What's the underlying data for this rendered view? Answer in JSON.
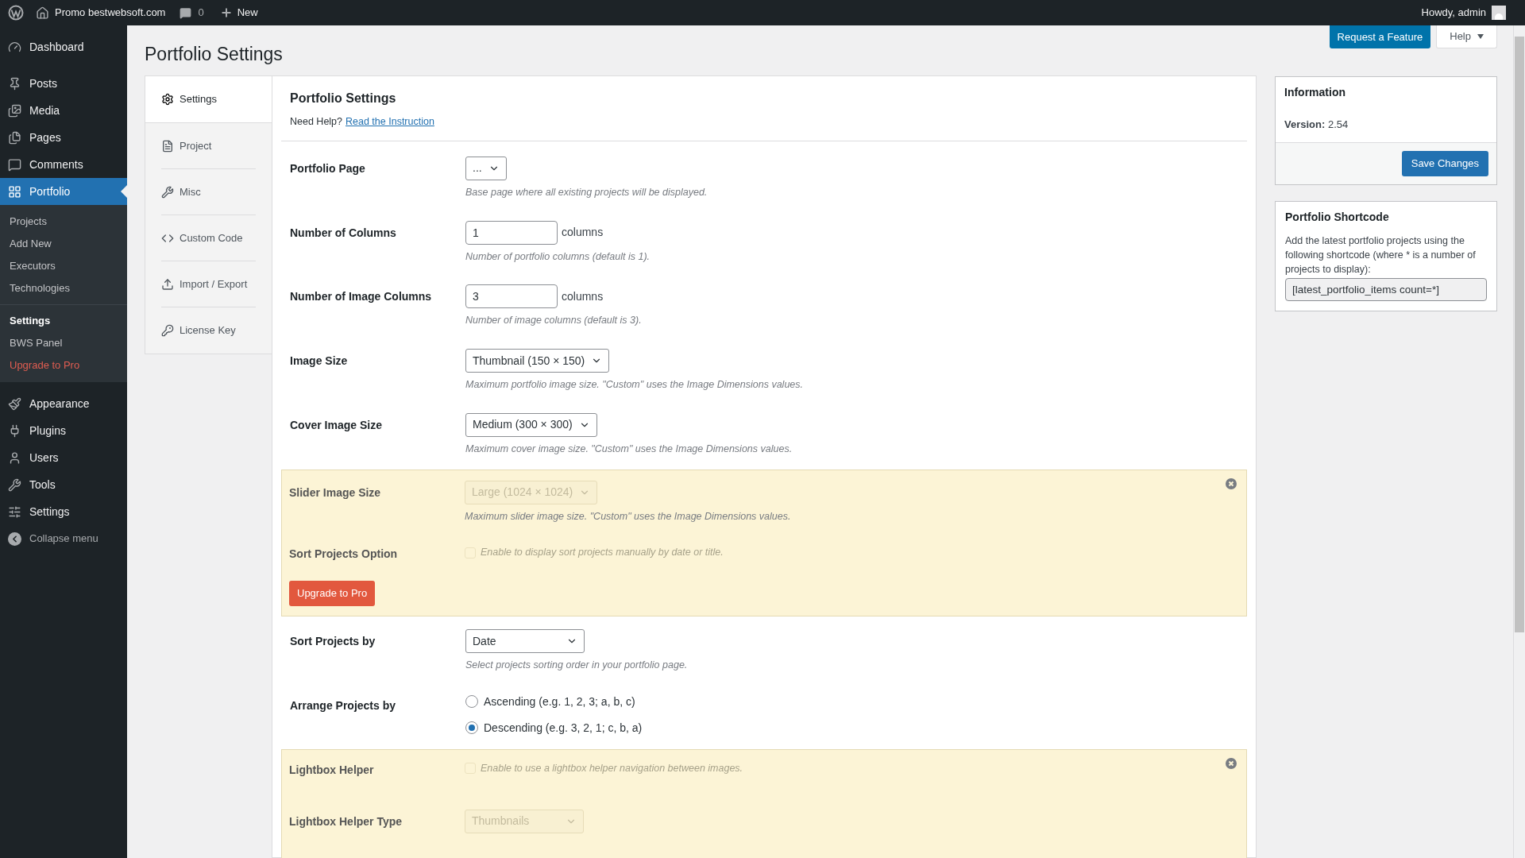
{
  "admin_bar": {
    "site": "Promo bestwebsoft.com",
    "comments": "0",
    "new": "New",
    "greeting": "Howdy, admin"
  },
  "menu": [
    {
      "label": "Dashboard",
      "selected": false
    },
    {
      "label": "Posts",
      "selected": false
    },
    {
      "label": "Media",
      "selected": false
    },
    {
      "label": "Pages",
      "selected": false
    },
    {
      "label": "Comments",
      "selected": false
    },
    {
      "label": "Portfolio",
      "selected": true,
      "submenu": [
        {
          "items": [
            {
              "label": "Projects",
              "selected": false,
              "kind": "link"
            },
            {
              "label": "Add New",
              "selected": false,
              "kind": "link"
            },
            {
              "label": "Executors",
              "selected": false,
              "kind": "link"
            },
            {
              "label": "Technologies",
              "selected": false,
              "kind": "link"
            }
          ]
        },
        {
          "items": [
            {
              "label": "Settings",
              "selected": true,
              "kind": "link"
            },
            {
              "label": "BWS Panel",
              "selected": false,
              "kind": "link"
            },
            {
              "label": "Upgrade to Pro",
              "selected": false,
              "kind": "upgrade"
            }
          ]
        }
      ]
    },
    {
      "label": "Appearance",
      "selected": false
    },
    {
      "label": "Plugins",
      "selected": false
    },
    {
      "label": "Users",
      "selected": false
    },
    {
      "label": "Tools",
      "selected": false
    },
    {
      "label": "Settings",
      "selected": false
    }
  ],
  "collapse_menu": "Collapse menu",
  "page_title": "Portfolio Settings",
  "header_buttons": {
    "request": "Request a Feature",
    "help": "Help"
  },
  "tabs": [
    {
      "label": "Settings",
      "selected": true
    },
    {
      "label": "Project",
      "selected": false
    },
    {
      "label": "Misc",
      "selected": false
    },
    {
      "label": "Custom Code",
      "selected": false
    },
    {
      "label": "Import / Export",
      "selected": false
    },
    {
      "label": "License Key",
      "selected": false
    }
  ],
  "panel": {
    "title": "Portfolio Settings",
    "help_text": "Need Help?",
    "help_link": "Read the Instruction"
  },
  "sections": [
    {
      "kind": "normal",
      "rows": [
        {
          "kind": "select",
          "label": "Portfolio Page",
          "value": "...",
          "description": "Base page where all existing projects will be displayed.",
          "disabled": false
        },
        {
          "kind": "number",
          "label": "Number of Columns",
          "value": "1",
          "unit": "columns",
          "description": "Number of portfolio columns (default is 1)."
        },
        {
          "kind": "number",
          "label": "Number of Image Columns",
          "value": "3",
          "unit": "columns",
          "description": "Number of image columns (default is 3)."
        },
        {
          "kind": "select",
          "label": "Image Size",
          "value": "Thumbnail (150 × 150)",
          "description": "Maximum portfolio image size. \"Custom\" uses the Image Dimensions values.",
          "disabled": false
        },
        {
          "kind": "select",
          "label": "Cover Image Size",
          "value": "Medium (300 × 300)",
          "description": "Maximum cover image size. \"Custom\" uses the Image Dimensions values.",
          "disabled": false
        }
      ]
    },
    {
      "kind": "pro",
      "button": "Upgrade to Pro",
      "rows": [
        {
          "kind": "select",
          "label": "Slider Image Size",
          "value": "Large (1024 × 1024)",
          "description": "Maximum slider image size. \"Custom\" uses the Image Dimensions values.",
          "disabled": true
        },
        {
          "kind": "checkbox",
          "label": "Sort Projects Option",
          "checked": false,
          "text": "Enable to display sort projects manually by date or title.",
          "disabled": true
        }
      ]
    },
    {
      "kind": "normal",
      "rows": [
        {
          "kind": "select",
          "label": "Sort Projects by",
          "value": "Date",
          "description": "Select projects sorting order in your portfolio page.",
          "disabled": false
        },
        {
          "kind": "radio",
          "label": "Arrange Projects by",
          "options": [
            {
              "label": "Ascending (e.g. 1, 2, 3; a, b, c)",
              "selected": false
            },
            {
              "label": "Descending (e.g. 3, 2, 1; c, b, a)",
              "selected": true
            }
          ]
        }
      ]
    },
    {
      "kind": "pro",
      "rows": [
        {
          "kind": "checkbox",
          "label": "Lightbox Helper",
          "checked": false,
          "text": "Enable to use a lightbox helper navigation between images.",
          "disabled": true
        },
        {
          "kind": "select",
          "label": "Lightbox Helper Type",
          "value": "Thumbnails",
          "disabled": true
        }
      ]
    }
  ],
  "info": {
    "title": "Information",
    "version": "**Version:** 2.54",
    "save": "Save Changes"
  },
  "shortcode": {
    "title": "Portfolio Shortcode",
    "text": "Add the latest portfolio projects using the following shortcode (where * is a number of projects to display):",
    "value": "[latest_portfolio_items count=*]"
  }
}
